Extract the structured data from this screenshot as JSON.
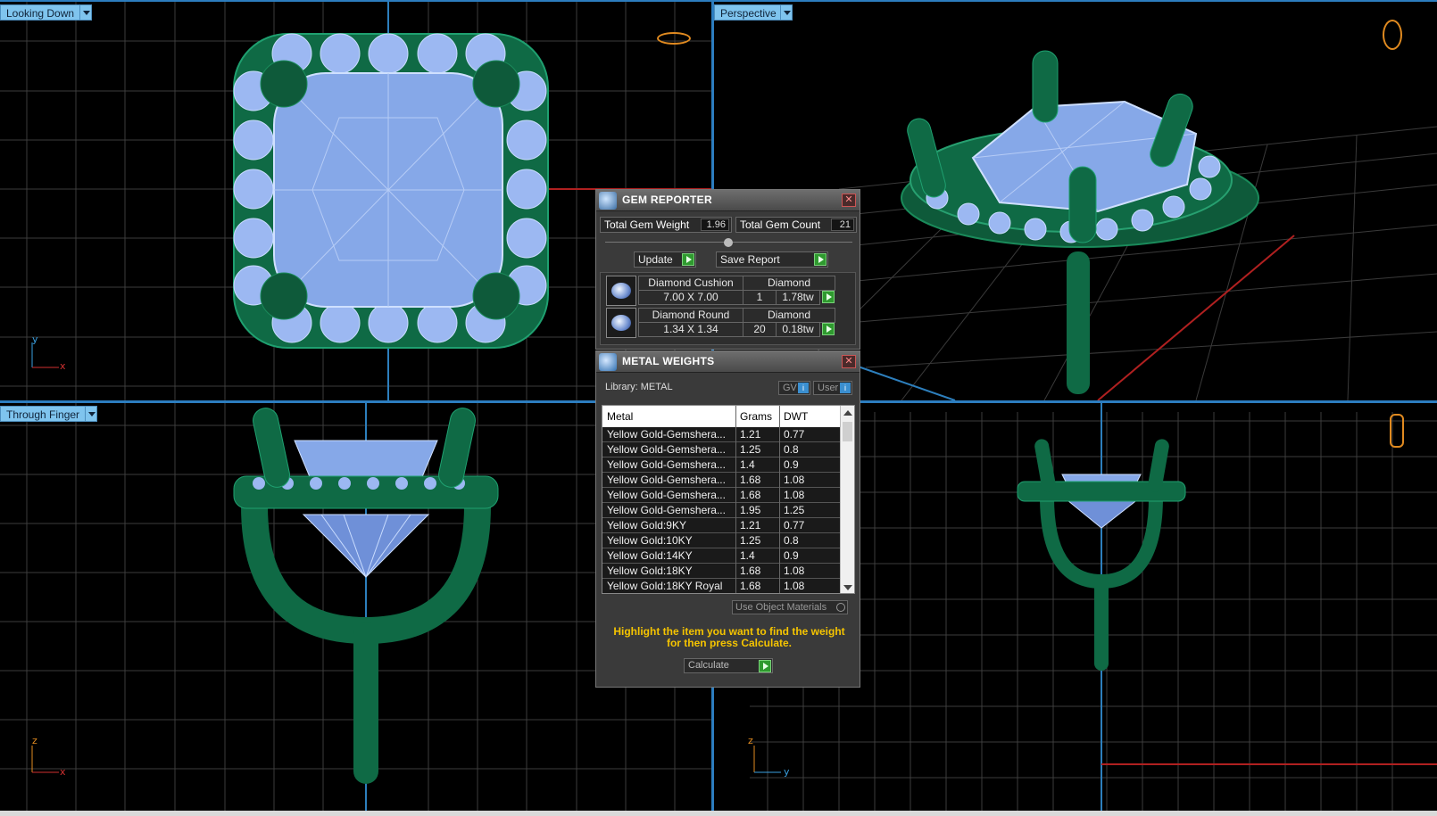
{
  "viewports": {
    "top_left": {
      "label": "Looking Down",
      "axis_labels": [
        "y",
        "x"
      ]
    },
    "top_right": {
      "label": "Perspective"
    },
    "bottom_left": {
      "label": "Through Finger",
      "axis_labels": [
        "z",
        "x"
      ]
    },
    "bottom_right": {
      "axis_labels": [
        "z",
        "y"
      ]
    }
  },
  "gem_reporter": {
    "title": "GEM REPORTER",
    "total_weight_label": "Total Gem Weight",
    "total_weight_value": "1.96",
    "total_count_label": "Total Gem Count",
    "total_count_value": "21",
    "update_label": "Update",
    "save_report_label": "Save Report",
    "gems": [
      {
        "name": "Diamond Cushion",
        "size": "7.00 X 7.00",
        "material": "Diamond",
        "count": "1",
        "weight": "1.78tw"
      },
      {
        "name": "Diamond Round",
        "size": "1.34 X 1.34",
        "material": "Diamond",
        "count": "20",
        "weight": "0.18tw"
      }
    ]
  },
  "metal_weights": {
    "title": "METAL WEIGHTS",
    "library_label": "Library: METAL",
    "gv_label": "GV",
    "user_label": "User",
    "columns": [
      "Metal",
      "Grams",
      "DWT"
    ],
    "rows": [
      [
        "Yellow Gold-Gemshera...",
        "1.21",
        "0.77"
      ],
      [
        "Yellow Gold-Gemshera...",
        "1.25",
        "0.8"
      ],
      [
        "Yellow Gold-Gemshera...",
        "1.4",
        "0.9"
      ],
      [
        "Yellow Gold-Gemshera...",
        "1.68",
        "1.08"
      ],
      [
        "Yellow Gold-Gemshera...",
        "1.68",
        "1.08"
      ],
      [
        "Yellow Gold-Gemshera...",
        "1.95",
        "1.25"
      ],
      [
        "Yellow Gold:9KY",
        "1.21",
        "0.77"
      ],
      [
        "Yellow Gold:10KY",
        "1.25",
        "0.8"
      ],
      [
        "Yellow Gold:14KY",
        "1.4",
        "0.9"
      ],
      [
        "Yellow Gold:18KY",
        "1.68",
        "1.08"
      ],
      [
        "Yellow Gold:18KY Royal",
        "1.68",
        "1.08"
      ]
    ],
    "use_object_materials_label": "Use Object Materials",
    "instruction": "Highlight the item you want to find the weight for then press Calculate.",
    "calculate_label": "Calculate"
  },
  "colors": {
    "metal_green": "#0f6a45",
    "gem_blue": "#8ab0ee",
    "grid_line": "#3a3a3a",
    "viewport_label_bg": "#7fc4ee",
    "instruction_text": "#f5c400"
  }
}
